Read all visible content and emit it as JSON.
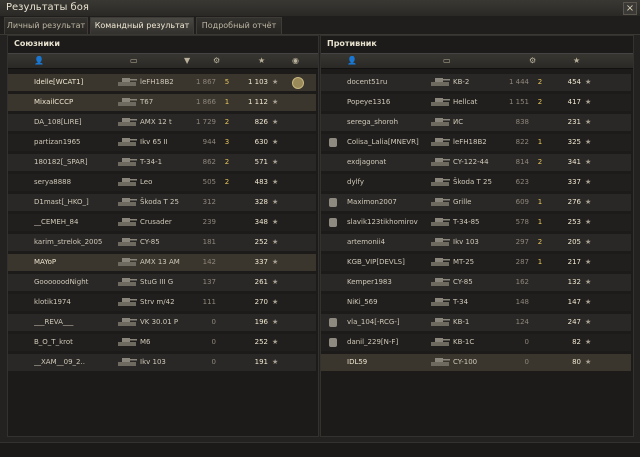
{
  "window": {
    "title": "Результаты боя",
    "close_label": "×"
  },
  "tabs": [
    {
      "label": "Личный результат",
      "active": false
    },
    {
      "label": "Командный результат",
      "active": true
    },
    {
      "label": "Подробный отчёт",
      "active": false
    }
  ],
  "allies": {
    "title": "Союзники",
    "rows": [
      {
        "name": "Idelle[WCAT1]",
        "tank": "leFH18B2",
        "rating": "1 867",
        "kills": "5",
        "xp": "1 103",
        "alive": true,
        "medal": true
      },
      {
        "name": "MixailCCCP",
        "tank": "T67",
        "rating": "1 866",
        "kills": "1",
        "xp": "1 112",
        "alive": true
      },
      {
        "name": "DA_108[LIRE]",
        "tank": "AMX 12 t",
        "rating": "1 729",
        "kills": "2",
        "xp": "826"
      },
      {
        "name": "partizan1965",
        "tank": "Ikv 65 II",
        "rating": "944",
        "kills": "3",
        "xp": "630"
      },
      {
        "name": "180182[_SPAR]",
        "tank": "T-34-1",
        "rating": "862",
        "kills": "2",
        "xp": "571"
      },
      {
        "name": "serya8888",
        "tank": "Leo",
        "rating": "505",
        "kills": "2",
        "xp": "483"
      },
      {
        "name": "D1mast[_HKO_]",
        "tank": "Škoda T 25",
        "rating": "312",
        "kills": "",
        "xp": "328"
      },
      {
        "name": "__CEMEH_84",
        "tank": "Crusader",
        "rating": "239",
        "kills": "",
        "xp": "348"
      },
      {
        "name": "karim_strelok_2005",
        "tank": "CY-85",
        "rating": "181",
        "kills": "",
        "xp": "252"
      },
      {
        "name": "MAYoP",
        "tank": "AMX 13 AM",
        "rating": "142",
        "kills": "",
        "xp": "337",
        "alive": true
      },
      {
        "name": "GoooooodNight",
        "tank": "StuG III G",
        "rating": "137",
        "kills": "",
        "xp": "261"
      },
      {
        "name": "klotik1974",
        "tank": "Strv m/42",
        "rating": "111",
        "kills": "",
        "xp": "270"
      },
      {
        "name": "___REVA___",
        "tank": "VK 30.01 P",
        "rating": "0",
        "kills": "",
        "xp": "196"
      },
      {
        "name": "B_O_T_krot",
        "tank": "M6",
        "rating": "0",
        "kills": "",
        "xp": "252"
      },
      {
        "name": "__XAM__09_2..",
        "tank": "Ikv 103",
        "rating": "0",
        "kills": "",
        "xp": "191"
      }
    ]
  },
  "enemies": {
    "title": "Противник",
    "rows": [
      {
        "name": "docent51ru",
        "tank": "KB-2",
        "rating": "1 444",
        "kills": "2",
        "xp": "454"
      },
      {
        "name": "Popeye1316",
        "tank": "Hellcat",
        "rating": "1 151",
        "kills": "2",
        "xp": "417"
      },
      {
        "name": "serega_shoroh",
        "tank": "ИС",
        "rating": "838",
        "kills": "",
        "xp": "231"
      },
      {
        "name": "Colisa_Lalia[MNEVR]",
        "tank": "leFH18B2",
        "rating": "822",
        "kills": "1",
        "xp": "325",
        "platoon": true
      },
      {
        "name": "exdjagonat",
        "tank": "CY-122-44",
        "rating": "814",
        "kills": "2",
        "xp": "341"
      },
      {
        "name": "dylfy",
        "tank": "Škoda T 25",
        "rating": "623",
        "kills": "",
        "xp": "337"
      },
      {
        "name": "Maximon2007",
        "tank": "Grille",
        "rating": "609",
        "kills": "1",
        "xp": "276",
        "platoon": true
      },
      {
        "name": "slavik123tikhomirov",
        "tank": "T-34-85",
        "rating": "578",
        "kills": "1",
        "xp": "253",
        "platoon": true
      },
      {
        "name": "artemonii4",
        "tank": "Ikv 103",
        "rating": "297",
        "kills": "2",
        "xp": "205"
      },
      {
        "name": "KGB_VIP[DEVLS]",
        "tank": "MT-25",
        "rating": "287",
        "kills": "1",
        "xp": "217"
      },
      {
        "name": "Kemper1983",
        "tank": "CY-85",
        "rating": "162",
        "kills": "",
        "xp": "132"
      },
      {
        "name": "NiKi_569",
        "tank": "T-34",
        "rating": "148",
        "kills": "",
        "xp": "147"
      },
      {
        "name": "vla_104[-RCG-]",
        "tank": "KB-1",
        "rating": "124",
        "kills": "",
        "xp": "247",
        "platoon": true
      },
      {
        "name": "danil_229[N-F]",
        "tank": "KB-1C",
        "rating": "0",
        "kills": "",
        "xp": "82",
        "platoon": true
      },
      {
        "name": "IDL59",
        "tank": "CY-100",
        "rating": "0",
        "kills": "",
        "xp": "80",
        "alive": true
      }
    ]
  },
  "colors": {
    "accent": "#e6c65a",
    "bg": "#1c1b19",
    "row_alt": "#2a2826"
  }
}
